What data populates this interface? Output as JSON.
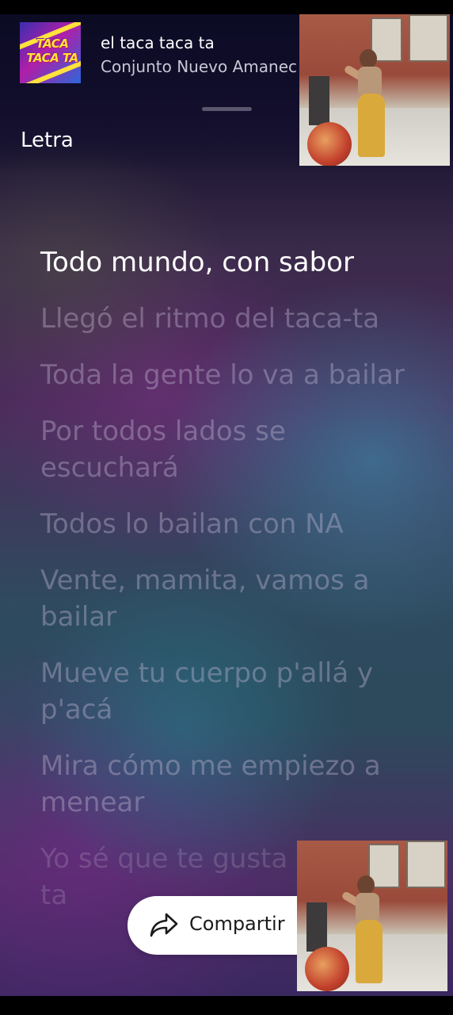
{
  "now_playing": {
    "title": "el taca taca ta",
    "artist": "Conjunto Nuevo Amanec",
    "album_art_text": [
      "TACA",
      "TACA TA"
    ]
  },
  "section_title": "Letra",
  "lyrics": [
    "Todo mundo, con sabor",
    "Llegó el ritmo del taca-ta",
    "Toda la gente lo va a bailar",
    "Por todos lados se escuchará",
    "Todos lo bailan con NA",
    "Vente, mamita, vamos a bailar",
    "Mueve tu cuerpo p'allá y p'acá",
    "Mira cómo me empiezo a menear",
    "Yo sé que te gusta el taca-ta"
  ],
  "active_lyric_index": 0,
  "share": {
    "label": "Compartir",
    "icon": "share-arrow-icon"
  },
  "colors": {
    "active_text": "#ffffff",
    "inactive_text": "#c8bed7",
    "pill_background": "#ffffff"
  }
}
